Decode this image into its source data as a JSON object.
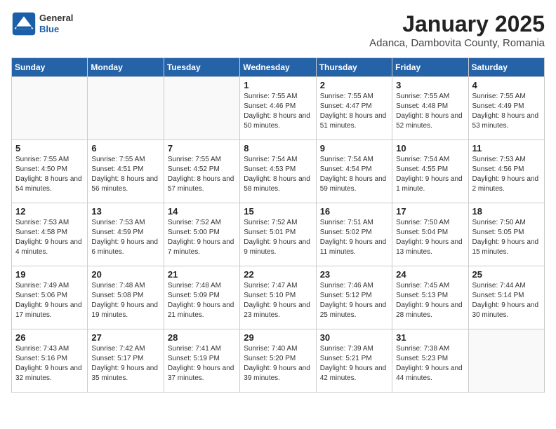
{
  "header": {
    "logo": {
      "general": "General",
      "blue": "Blue"
    },
    "title": "January 2025",
    "subtitle": "Adanca, Dambovita County, Romania"
  },
  "weekdays": [
    "Sunday",
    "Monday",
    "Tuesday",
    "Wednesday",
    "Thursday",
    "Friday",
    "Saturday"
  ],
  "weeks": [
    [
      {
        "day": "",
        "info": ""
      },
      {
        "day": "",
        "info": ""
      },
      {
        "day": "",
        "info": ""
      },
      {
        "day": "1",
        "info": "Sunrise: 7:55 AM\nSunset: 4:46 PM\nDaylight: 8 hours\nand 50 minutes."
      },
      {
        "day": "2",
        "info": "Sunrise: 7:55 AM\nSunset: 4:47 PM\nDaylight: 8 hours\nand 51 minutes."
      },
      {
        "day": "3",
        "info": "Sunrise: 7:55 AM\nSunset: 4:48 PM\nDaylight: 8 hours\nand 52 minutes."
      },
      {
        "day": "4",
        "info": "Sunrise: 7:55 AM\nSunset: 4:49 PM\nDaylight: 8 hours\nand 53 minutes."
      }
    ],
    [
      {
        "day": "5",
        "info": "Sunrise: 7:55 AM\nSunset: 4:50 PM\nDaylight: 8 hours\nand 54 minutes."
      },
      {
        "day": "6",
        "info": "Sunrise: 7:55 AM\nSunset: 4:51 PM\nDaylight: 8 hours\nand 56 minutes."
      },
      {
        "day": "7",
        "info": "Sunrise: 7:55 AM\nSunset: 4:52 PM\nDaylight: 8 hours\nand 57 minutes."
      },
      {
        "day": "8",
        "info": "Sunrise: 7:54 AM\nSunset: 4:53 PM\nDaylight: 8 hours\nand 58 minutes."
      },
      {
        "day": "9",
        "info": "Sunrise: 7:54 AM\nSunset: 4:54 PM\nDaylight: 8 hours\nand 59 minutes."
      },
      {
        "day": "10",
        "info": "Sunrise: 7:54 AM\nSunset: 4:55 PM\nDaylight: 9 hours\nand 1 minute."
      },
      {
        "day": "11",
        "info": "Sunrise: 7:53 AM\nSunset: 4:56 PM\nDaylight: 9 hours\nand 2 minutes."
      }
    ],
    [
      {
        "day": "12",
        "info": "Sunrise: 7:53 AM\nSunset: 4:58 PM\nDaylight: 9 hours\nand 4 minutes."
      },
      {
        "day": "13",
        "info": "Sunrise: 7:53 AM\nSunset: 4:59 PM\nDaylight: 9 hours\nand 6 minutes."
      },
      {
        "day": "14",
        "info": "Sunrise: 7:52 AM\nSunset: 5:00 PM\nDaylight: 9 hours\nand 7 minutes."
      },
      {
        "day": "15",
        "info": "Sunrise: 7:52 AM\nSunset: 5:01 PM\nDaylight: 9 hours\nand 9 minutes."
      },
      {
        "day": "16",
        "info": "Sunrise: 7:51 AM\nSunset: 5:02 PM\nDaylight: 9 hours\nand 11 minutes."
      },
      {
        "day": "17",
        "info": "Sunrise: 7:50 AM\nSunset: 5:04 PM\nDaylight: 9 hours\nand 13 minutes."
      },
      {
        "day": "18",
        "info": "Sunrise: 7:50 AM\nSunset: 5:05 PM\nDaylight: 9 hours\nand 15 minutes."
      }
    ],
    [
      {
        "day": "19",
        "info": "Sunrise: 7:49 AM\nSunset: 5:06 PM\nDaylight: 9 hours\nand 17 minutes."
      },
      {
        "day": "20",
        "info": "Sunrise: 7:48 AM\nSunset: 5:08 PM\nDaylight: 9 hours\nand 19 minutes."
      },
      {
        "day": "21",
        "info": "Sunrise: 7:48 AM\nSunset: 5:09 PM\nDaylight: 9 hours\nand 21 minutes."
      },
      {
        "day": "22",
        "info": "Sunrise: 7:47 AM\nSunset: 5:10 PM\nDaylight: 9 hours\nand 23 minutes."
      },
      {
        "day": "23",
        "info": "Sunrise: 7:46 AM\nSunset: 5:12 PM\nDaylight: 9 hours\nand 25 minutes."
      },
      {
        "day": "24",
        "info": "Sunrise: 7:45 AM\nSunset: 5:13 PM\nDaylight: 9 hours\nand 28 minutes."
      },
      {
        "day": "25",
        "info": "Sunrise: 7:44 AM\nSunset: 5:14 PM\nDaylight: 9 hours\nand 30 minutes."
      }
    ],
    [
      {
        "day": "26",
        "info": "Sunrise: 7:43 AM\nSunset: 5:16 PM\nDaylight: 9 hours\nand 32 minutes."
      },
      {
        "day": "27",
        "info": "Sunrise: 7:42 AM\nSunset: 5:17 PM\nDaylight: 9 hours\nand 35 minutes."
      },
      {
        "day": "28",
        "info": "Sunrise: 7:41 AM\nSunset: 5:19 PM\nDaylight: 9 hours\nand 37 minutes."
      },
      {
        "day": "29",
        "info": "Sunrise: 7:40 AM\nSunset: 5:20 PM\nDaylight: 9 hours\nand 39 minutes."
      },
      {
        "day": "30",
        "info": "Sunrise: 7:39 AM\nSunset: 5:21 PM\nDaylight: 9 hours\nand 42 minutes."
      },
      {
        "day": "31",
        "info": "Sunrise: 7:38 AM\nSunset: 5:23 PM\nDaylight: 9 hours\nand 44 minutes."
      },
      {
        "day": "",
        "info": ""
      }
    ]
  ]
}
